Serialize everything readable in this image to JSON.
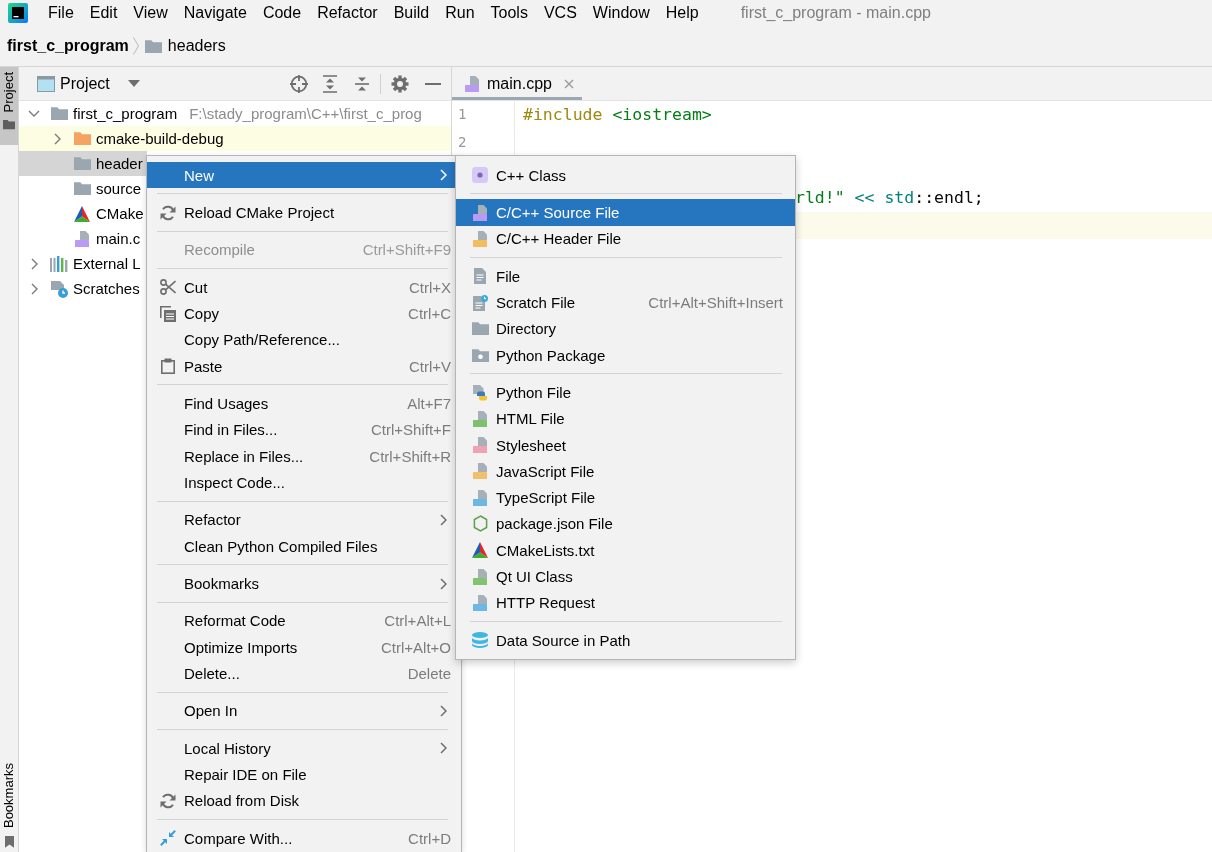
{
  "menubar": {
    "items": [
      "File",
      "Edit",
      "View",
      "Navigate",
      "Code",
      "Refactor",
      "Build",
      "Run",
      "Tools",
      "VCS",
      "Window",
      "Help"
    ],
    "title": "first_c_program - main.cpp"
  },
  "breadcrumbs": [
    {
      "label": "first_c_program",
      "kind": "project"
    },
    {
      "label": "headers",
      "kind": "folder"
    }
  ],
  "tool_strip": {
    "top": [
      {
        "label": "Project",
        "kind": "project",
        "selected": true
      }
    ],
    "bottom": [
      {
        "label": "Bookmarks",
        "kind": "bookmarks",
        "selected": false
      }
    ]
  },
  "project_panel": {
    "title": "Project",
    "tree": [
      {
        "label": "first_c_program",
        "path": "F:\\stady_program\\C++\\first_c_prog",
        "kind": "project",
        "expanded": true,
        "selected": false,
        "children": [
          {
            "label": "cmake-build-debug",
            "kind": "build-folder",
            "expanded": false,
            "selected": false,
            "color": "#fdfde4"
          },
          {
            "label": "header",
            "kind": "folder",
            "selected": true
          },
          {
            "label": "source",
            "kind": "folder",
            "selected": false
          },
          {
            "label": "CMake",
            "kind": "cmake",
            "selected": false
          },
          {
            "label": "main.c",
            "kind": "cpp",
            "selected": false
          }
        ]
      },
      {
        "label": "External L",
        "kind": "library",
        "expanded": false,
        "selected": false
      },
      {
        "label": "Scratches",
        "kind": "scratches",
        "expanded": false,
        "selected": false
      }
    ]
  },
  "editor": {
    "tabs": [
      {
        "label": "main.cpp",
        "kind": "cpp",
        "selected": true
      }
    ],
    "lines": [
      {
        "kind": "code",
        "number": "1",
        "current": false,
        "tokens": [
          {
            "text": "#include",
            "kind": "directive"
          },
          {
            "text": " <iostream>",
            "kind": "header"
          }
        ]
      },
      {
        "kind": "blank",
        "number": "2",
        "current": false
      },
      {
        "kind": "blank"
      },
      {
        "kind": "clipped",
        "current": false,
        "tokens": [
          {
            "text": "rld!\"",
            "kind": "string"
          },
          {
            "text": " << ",
            "kind": "operator"
          },
          {
            "text": "std",
            "kind": "namespace"
          },
          {
            "text": "::endl;",
            "kind": "plain"
          }
        ]
      },
      {
        "kind": "blank",
        "current": true
      }
    ]
  },
  "context_menu": {
    "items": [
      {
        "kind": "plain",
        "label": "New",
        "submenu": true,
        "selected": true,
        "disabled": false
      },
      {
        "kind": "separator"
      },
      {
        "kind": "reload",
        "label": "Reload CMake Project",
        "submenu": false,
        "selected": false,
        "disabled": false
      },
      {
        "kind": "separator"
      },
      {
        "kind": "plain",
        "label": "Recompile",
        "shortcut": "Ctrl+Shift+F9",
        "submenu": false,
        "selected": false,
        "disabled": true
      },
      {
        "kind": "separator"
      },
      {
        "kind": "cut",
        "label": "Cut",
        "shortcut": "Ctrl+X",
        "submenu": false,
        "selected": false,
        "disabled": false
      },
      {
        "kind": "copy",
        "label": "Copy",
        "shortcut": "Ctrl+C",
        "submenu": false,
        "selected": false,
        "disabled": false
      },
      {
        "kind": "plain",
        "label": "Copy Path/Reference...",
        "submenu": false,
        "selected": false,
        "disabled": false
      },
      {
        "kind": "paste",
        "label": "Paste",
        "shortcut": "Ctrl+V",
        "submenu": false,
        "selected": false,
        "disabled": false
      },
      {
        "kind": "separator"
      },
      {
        "kind": "plain",
        "label": "Find Usages",
        "shortcut": "Alt+F7",
        "submenu": false,
        "selected": false,
        "disabled": false
      },
      {
        "kind": "plain",
        "label": "Find in Files...",
        "shortcut": "Ctrl+Shift+F",
        "submenu": false,
        "selected": false,
        "disabled": false
      },
      {
        "kind": "plain",
        "label": "Replace in Files...",
        "shortcut": "Ctrl+Shift+R",
        "submenu": false,
        "selected": false,
        "disabled": false
      },
      {
        "kind": "plain",
        "label": "Inspect Code...",
        "submenu": false,
        "selected": false,
        "disabled": false
      },
      {
        "kind": "separator"
      },
      {
        "kind": "plain",
        "label": "Refactor",
        "submenu": true,
        "selected": false,
        "disabled": false
      },
      {
        "kind": "plain",
        "label": "Clean Python Compiled Files",
        "submenu": false,
        "selected": false,
        "disabled": false
      },
      {
        "kind": "separator"
      },
      {
        "kind": "plain",
        "label": "Bookmarks",
        "submenu": true,
        "selected": false,
        "disabled": false
      },
      {
        "kind": "separator"
      },
      {
        "kind": "plain",
        "label": "Reformat Code",
        "shortcut": "Ctrl+Alt+L",
        "submenu": false,
        "selected": false,
        "disabled": false
      },
      {
        "kind": "plain",
        "label": "Optimize Imports",
        "shortcut": "Ctrl+Alt+O",
        "submenu": false,
        "selected": false,
        "disabled": false
      },
      {
        "kind": "plain",
        "label": "Delete...",
        "shortcut": "Delete",
        "submenu": false,
        "selected": false,
        "disabled": false
      },
      {
        "kind": "separator"
      },
      {
        "kind": "plain",
        "label": "Open In",
        "submenu": true,
        "selected": false,
        "disabled": false
      },
      {
        "kind": "separator"
      },
      {
        "kind": "plain",
        "label": "Local History",
        "submenu": true,
        "selected": false,
        "disabled": false
      },
      {
        "kind": "plain",
        "label": "Repair IDE on File",
        "submenu": false,
        "selected": false,
        "disabled": false
      },
      {
        "kind": "reload",
        "label": "Reload from Disk",
        "submenu": false,
        "selected": false,
        "disabled": false
      },
      {
        "kind": "separator"
      },
      {
        "kind": "compare",
        "label": "Compare With...",
        "shortcut": "Ctrl+D",
        "submenu": false,
        "selected": false,
        "disabled": false
      }
    ]
  },
  "submenu": {
    "items": [
      {
        "kind": "class",
        "label": "C++ Class",
        "selected": false
      },
      {
        "kind": "separator"
      },
      {
        "kind": "source",
        "label": "C/C++ Source File",
        "selected": true
      },
      {
        "kind": "header",
        "label": "C/C++ Header File",
        "selected": false
      },
      {
        "kind": "separator"
      },
      {
        "kind": "file",
        "label": "File",
        "selected": false
      },
      {
        "kind": "scratch",
        "label": "Scratch File",
        "shortcut": "Ctrl+Alt+Shift+Insert",
        "selected": false
      },
      {
        "kind": "directory",
        "label": "Directory",
        "selected": false
      },
      {
        "kind": "package",
        "label": "Python Package",
        "selected": false
      },
      {
        "kind": "separator"
      },
      {
        "kind": "python",
        "label": "Python File",
        "selected": false
      },
      {
        "kind": "html",
        "label": "HTML File",
        "selected": false
      },
      {
        "kind": "stylesheet",
        "label": "Stylesheet",
        "selected": false
      },
      {
        "kind": "javascript",
        "label": "JavaScript File",
        "selected": false
      },
      {
        "kind": "typescript",
        "label": "TypeScript File",
        "selected": false
      },
      {
        "kind": "nodejs",
        "label": "package.json File",
        "selected": false
      },
      {
        "kind": "cmake",
        "label": "CMakeLists.txt",
        "selected": false
      },
      {
        "kind": "qt",
        "label": "Qt UI Class",
        "selected": false
      },
      {
        "kind": "http",
        "label": "HTTP Request",
        "selected": false
      },
      {
        "kind": "separator"
      },
      {
        "kind": "database",
        "label": "Data Source in Path",
        "selected": false
      }
    ]
  }
}
